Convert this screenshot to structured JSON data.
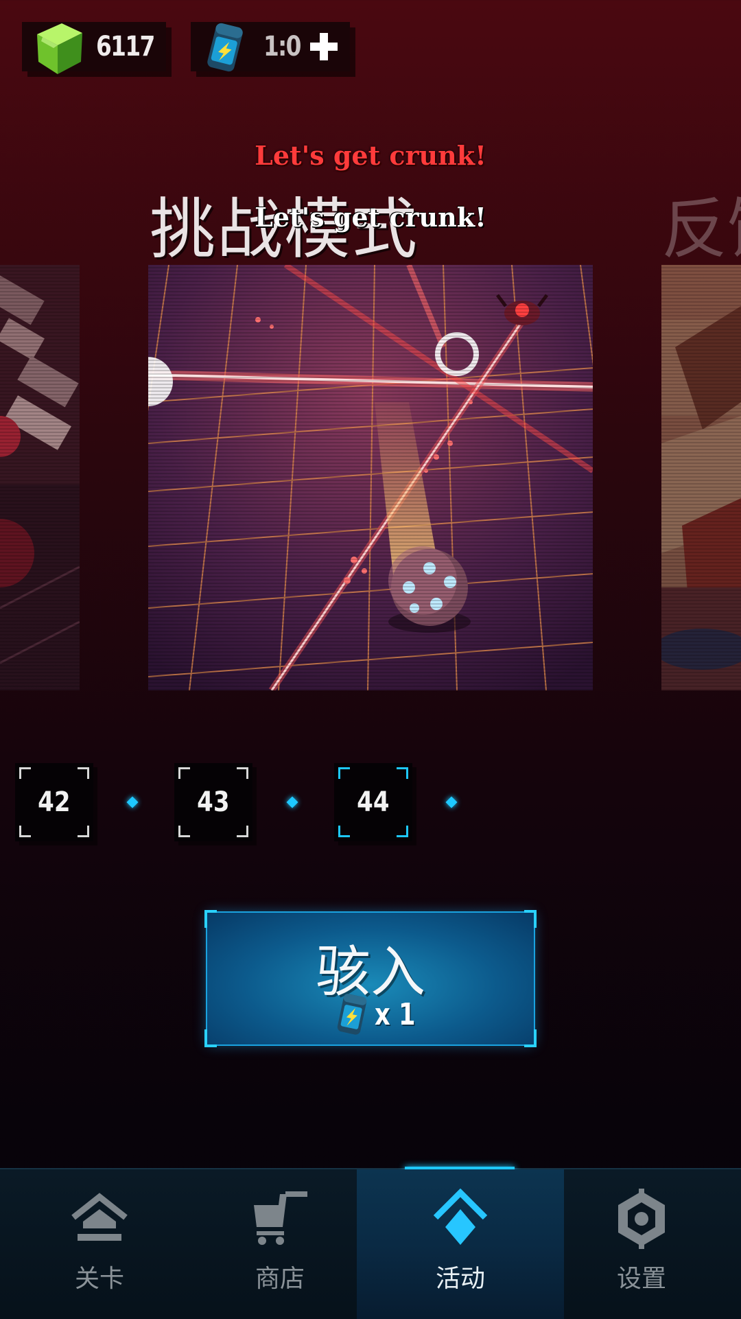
{
  "currency": {
    "gems": "6117",
    "energy": "1:0"
  },
  "toast": {
    "tagline_red": "Let's get crunk!",
    "tagline_white": "Let's get crunk!"
  },
  "mode": {
    "title": "挑战模式",
    "next_title_partial": "反馈"
  },
  "levels": [
    {
      "number": "42",
      "active": false
    },
    {
      "number": "43",
      "active": false
    },
    {
      "number": "44",
      "active": true
    }
  ],
  "enter_button": {
    "label": "骇入",
    "cost": "x 1",
    "cost_icon": "energy-canister-icon"
  },
  "nav": {
    "items": [
      {
        "label": "关卡",
        "icon": "home-icon",
        "active": false
      },
      {
        "label": "商店",
        "icon": "cart-icon",
        "active": false
      },
      {
        "label": "活动",
        "icon": "diamond-chevron-icon",
        "active": true
      },
      {
        "label": "设置",
        "icon": "gear-icon",
        "active": false
      }
    ]
  },
  "colors": {
    "accent": "#1ec8ff",
    "toast_red": "#ff3b3b",
    "gem_green": "#7ddc3a"
  }
}
